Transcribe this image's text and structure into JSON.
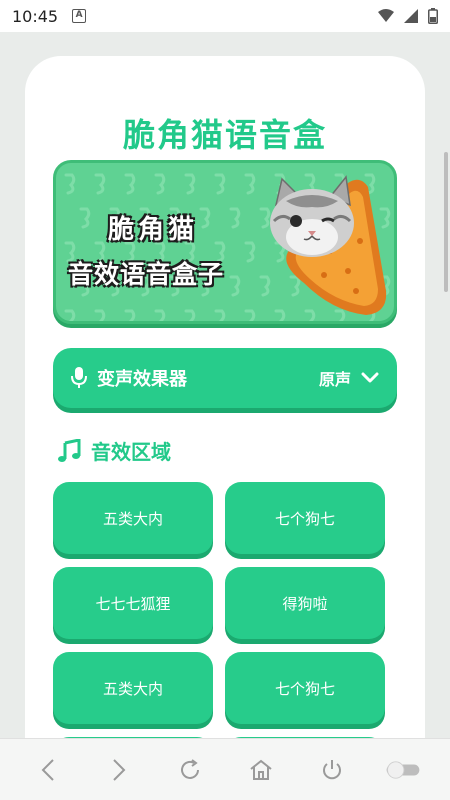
{
  "status_bar": {
    "time": "10:45",
    "notification_icon_letter": "A",
    "icons": [
      "wifi-icon",
      "signal-icon",
      "battery-icon"
    ]
  },
  "app": {
    "title": "脆角猫语音盒"
  },
  "banner": {
    "line1": "脆角猫",
    "line2": "音效语音盒子",
    "art": "cat-on-chip-illustration"
  },
  "voice_changer": {
    "icon": "microphone-icon",
    "label": "变声效果器",
    "selected": "原声"
  },
  "sound_section": {
    "icon": "music-note-icon",
    "title": "音效区域",
    "buttons": [
      {
        "label": "五类大内"
      },
      {
        "label": "七个狗七"
      },
      {
        "label": "七七七狐狸"
      },
      {
        "label": "得狗啦"
      },
      {
        "label": "五类大内"
      },
      {
        "label": "七个狗七"
      },
      {
        "label": ""
      },
      {
        "label": ""
      }
    ]
  },
  "nav_bar": {
    "buttons": [
      "back-icon",
      "forward-icon",
      "refresh-icon",
      "home-icon",
      "power-icon",
      "toggle-switch"
    ]
  },
  "colors": {
    "accent": "#22c98a",
    "button": "#27cc8b",
    "button_shadow": "#1ba96f",
    "banner_bg": "#5fd293",
    "page_bg": "#e9ecea"
  }
}
